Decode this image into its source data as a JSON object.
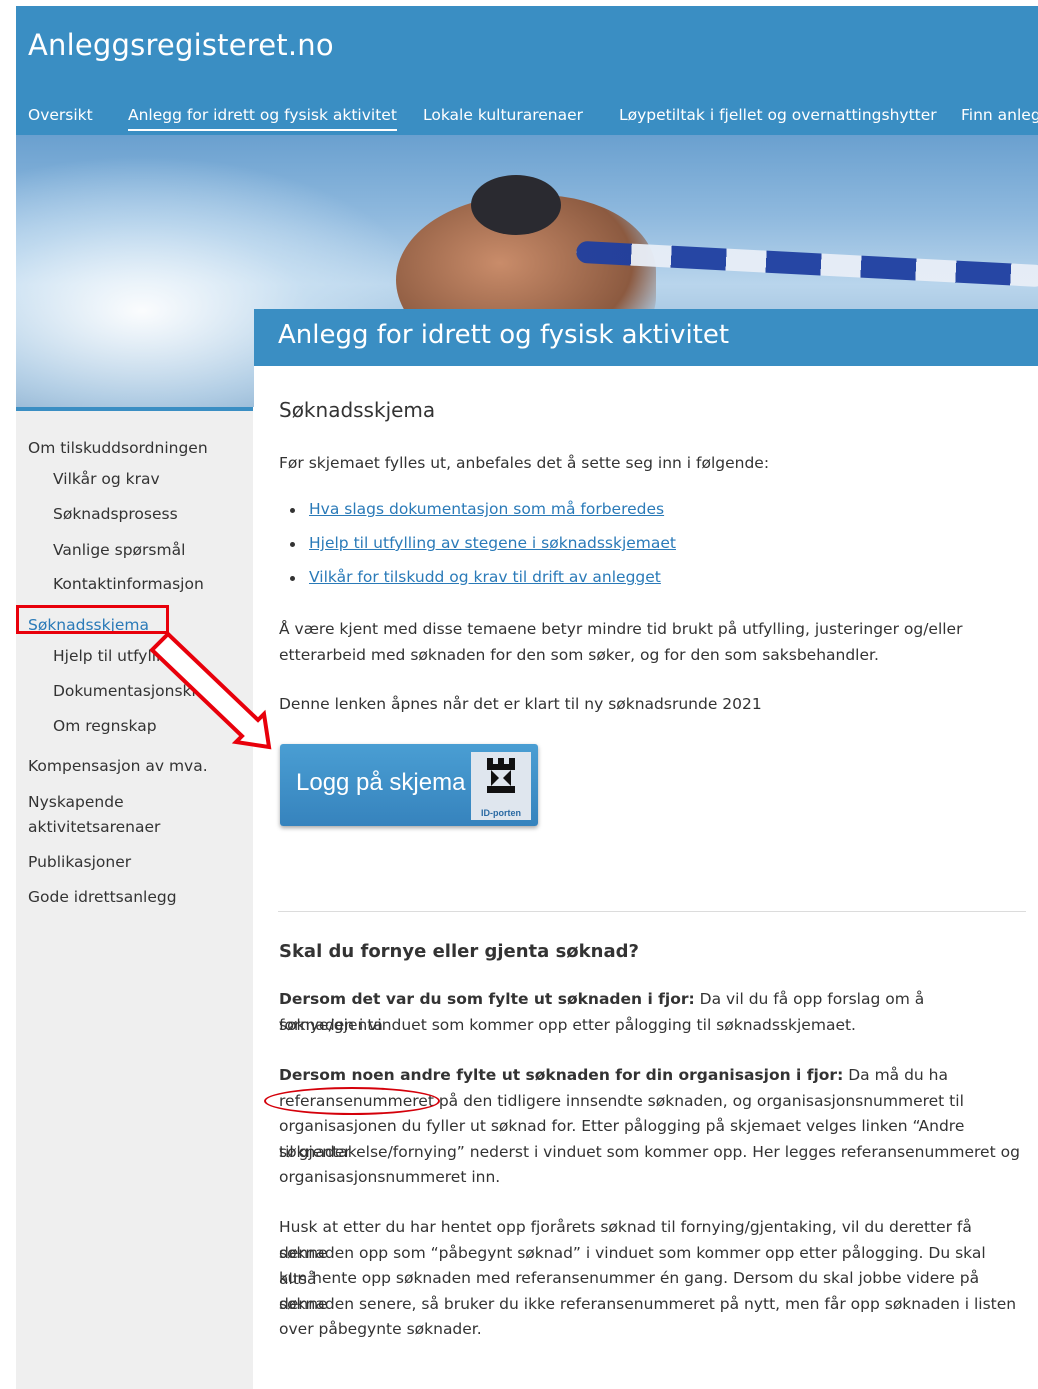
{
  "header": {
    "site_title": "Anleggsregisteret.no",
    "nav": [
      "Oversikt",
      "Anlegg for idrett og fysisk aktivitet",
      "Lokale kulturarenaer",
      "Løypetiltak i fjellet og overnattingshytter",
      "Finn anleg"
    ]
  },
  "sidebar": {
    "items": [
      {
        "label": "Om tilskuddsordningen"
      },
      {
        "label": "Vilkår og krav"
      },
      {
        "label": "Søknadsprosess"
      },
      {
        "label": "Vanlige spørsmål"
      },
      {
        "label": "Kontaktinformasjon"
      },
      {
        "label": "Søknadsskjema"
      },
      {
        "label": "Hjelp til utfylling"
      },
      {
        "label": "Dokumentasjonskrav"
      },
      {
        "label": "Om regnskap"
      },
      {
        "label": "Kompensasjon av mva."
      },
      {
        "label": "Nyskapende"
      },
      {
        "label": "aktivitetsarenaer"
      },
      {
        "label": "Publikasjoner"
      },
      {
        "label": "Gode idrettsanlegg"
      }
    ]
  },
  "content": {
    "banner_title": "Anlegg for idrett og fysisk aktivitet",
    "heading": "Søknadsskjema",
    "intro": "Før skjemaet fylles ut, anbefales det å sette seg inn i følgende:",
    "links": [
      "Hva slags dokumentasjon som må forberedes",
      "Hjelp til utfylling av stegene i søknadsskjemaet",
      "Vilkår for tilskudd og krav til drift av anlegget"
    ],
    "para1_line1": "Å være kjent med disse temaene betyr mindre tid brukt på utfylling, justeringer og/eller",
    "para1_line2": "etterarbeid med søknaden for den som søker, og for den som saksbehandler.",
    "para2": "Denne lenken åpnes når det er klart til ny søknadsrunde 2021",
    "login_button": "Logg på skjema",
    "idporten_label": "ID-porten",
    "renew_heading": "Skal du fornye eller gjenta søknad?",
    "block1_bold": "Dersom det var du som fylte ut søknaden i fjor:",
    "block1_rest": " Da vil du få opp forslag om å fornye/gjenta",
    "block1_line2": "søknaden i vinduet som kommer opp etter pålogging til søknadsskjemaet.",
    "block2_bold": "Dersom noen andre fylte ut søknaden for din organisasjon i fjor:",
    "block2_rest": " Da må du ha",
    "block2_lines": [
      "referansenummeret på den tidligere innsendte søknaden, og organisasjonsnummeret til",
      "organisasjonen du fyller ut søknad for. Etter pålogging på skjemaet velges linken “Andre søknader",
      "til gjentakelse/fornying” nederst i vinduet som kommer opp. Her legges referansenummeret og",
      "organisasjonsnummeret inn."
    ],
    "block3_lines": [
      "Husk at etter du har hentet opp fjorårets søknad til fornying/gjentaking, vil du deretter få denne",
      "søknaden opp som “påbegynt søknad” i vinduet som kommer opp etter pålogging. Du skal altså",
      "kun hente opp søknaden med referansenummer én gang. Dersom du skal jobbe videre på denne",
      "søknaden senere, så bruker du ikke referansenummeret på nytt, men får opp søknaden i listen",
      "over påbegynte søknader."
    ]
  },
  "colors": {
    "header_blue": "#3a8ec3",
    "link_blue": "#2a7ab8",
    "annotation_red": "#e8000b"
  }
}
